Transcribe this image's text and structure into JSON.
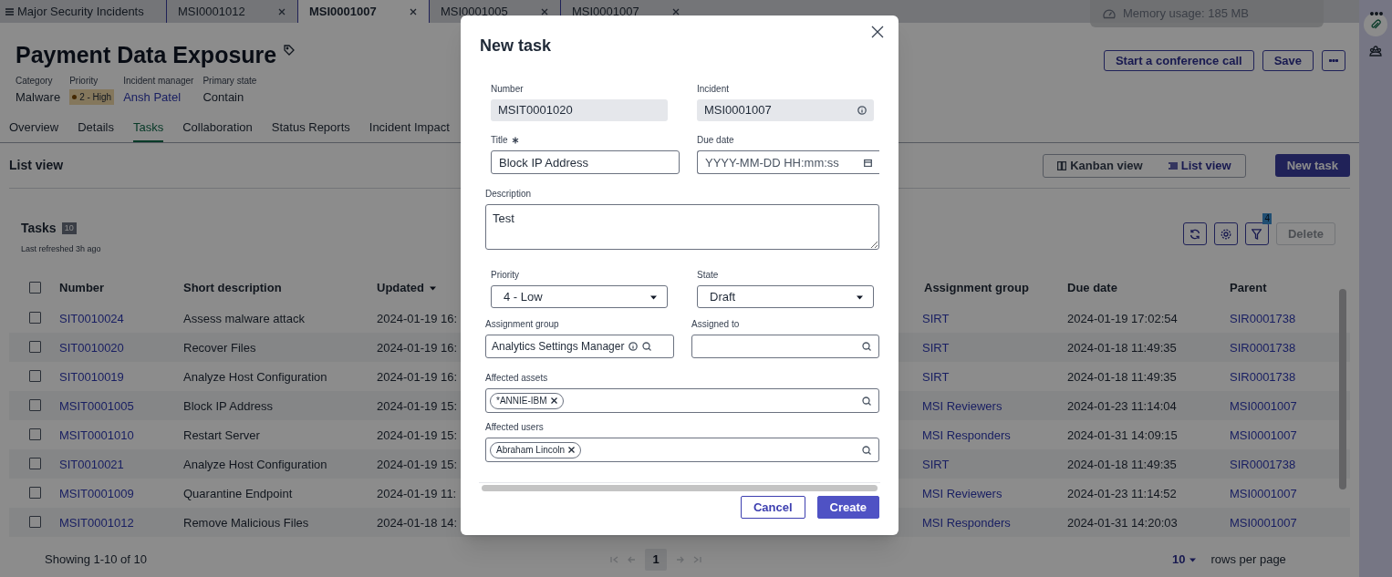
{
  "app_tabs": [
    {
      "label": "Major Security Incidents",
      "kind": "menu",
      "selected": false
    },
    {
      "label": "MSI0001012",
      "kind": "record",
      "selected": false
    },
    {
      "label": "MSI0001007",
      "kind": "record",
      "selected": true
    },
    {
      "label": "MSI0001005",
      "kind": "record",
      "selected": false
    },
    {
      "label": "MSI0001007",
      "kind": "record",
      "selected": false
    }
  ],
  "memory_toast": "Memory usage: 185 MB",
  "record": {
    "title": "Payment Data Exposure",
    "fields": [
      {
        "label": "Category",
        "value": "Malware",
        "kind": "text"
      },
      {
        "label": "Priority",
        "value": "2 - High",
        "kind": "badge"
      },
      {
        "label": "Incident manager",
        "value": "Ansh Patel",
        "kind": "link"
      },
      {
        "label": "Primary state",
        "value": "Contain",
        "kind": "text"
      }
    ],
    "actions": [
      "Start a conference call",
      "Save"
    ]
  },
  "nav_tabs": [
    {
      "label": "Overview",
      "selected": false
    },
    {
      "label": "Details",
      "selected": false
    },
    {
      "label": "Tasks",
      "selected": true
    },
    {
      "label": "Collaboration",
      "selected": false
    },
    {
      "label": "Status Reports",
      "selected": false
    },
    {
      "label": "Incident Impact",
      "selected": false
    }
  ],
  "view_bar": {
    "title": "List view",
    "views": [
      {
        "label": "Kanban view",
        "kind": "kanban",
        "selected": false
      },
      {
        "label": "List view",
        "kind": "list",
        "selected": true
      }
    ],
    "new_button": "New task"
  },
  "tasks": {
    "title": "Tasks",
    "count": "10",
    "refreshed": "Last refreshed 3h ago",
    "filter_count": "4",
    "delete_button": "Delete",
    "select_all_checked": false,
    "columns": [
      "Number",
      "Short description",
      "Updated",
      "Assignment group",
      "Due date",
      "Parent"
    ],
    "rows": [
      {
        "checked": false,
        "cells": [
          "SIT0010024",
          "Assess malware attack",
          "2024-01-19 16:",
          "SIRT",
          "2024-01-19 17:02:54",
          "SIR0001738"
        ]
      },
      {
        "checked": false,
        "cells": [
          "SIT0010020",
          "Recover Files",
          "2024-01-19 16:",
          "SIRT",
          "2024-01-18 11:49:35",
          "SIR0001738"
        ]
      },
      {
        "checked": false,
        "cells": [
          "SIT0010019",
          "Analyze Host Configuration",
          "2024-01-19 16:",
          "SIRT",
          "2024-01-18 11:49:35",
          "SIR0001738"
        ]
      },
      {
        "checked": false,
        "cells": [
          "MSIT0001005",
          "Block IP Address",
          "2024-01-19 15:",
          "MSI Reviewers",
          "2024-01-23 11:14:04",
          "MSI0001007"
        ]
      },
      {
        "checked": false,
        "cells": [
          "MSIT0001010",
          "Restart Server",
          "2024-01-19 15:",
          "MSI Responders",
          "2024-01-31 14:09:15",
          "MSI0001007"
        ]
      },
      {
        "checked": false,
        "cells": [
          "SIT0010021",
          "Analyze Host Configuration",
          "2024-01-19 15:",
          "SIRT",
          "2024-01-18 11:49:35",
          "SIR0001738"
        ]
      },
      {
        "checked": false,
        "cells": [
          "MSIT0001009",
          "Quarantine Endpoint",
          "2024-01-19 11:",
          "MSI Reviewers",
          "2024-01-23 11:14:52",
          "MSI0001007"
        ]
      },
      {
        "checked": false,
        "cells": [
          "MSIT0001012",
          "Remove Malicious Files",
          "2024-01-18 14:",
          "MSI Responders",
          "2024-01-31 14:20:03",
          "MSI0001007"
        ]
      }
    ],
    "showing": "Showing 1-10 of 10",
    "page": "1",
    "rows_per_page": "10",
    "rows_per_page_label": "rows per page"
  },
  "modal": {
    "title": "New task",
    "number": {
      "label": "Number",
      "value": "MSIT0001020"
    },
    "incident": {
      "label": "Incident",
      "value": "MSI0001007"
    },
    "title_field": {
      "label": "Title",
      "required": true,
      "value": "Block IP Address"
    },
    "due_date": {
      "label": "Due date",
      "placeholder": "YYYY-MM-DD HH:mm:ss"
    },
    "description": {
      "label": "Description",
      "value": "Test"
    },
    "priority": {
      "label": "Priority",
      "value": "4 - Low"
    },
    "state": {
      "label": "State",
      "value": "Draft"
    },
    "assignment_group": {
      "label": "Assignment group",
      "value": "Analytics Settings Manager"
    },
    "assigned_to": {
      "label": "Assigned to"
    },
    "affected_assets": {
      "label": "Affected assets",
      "chips": [
        "*ANNIE-IBM"
      ]
    },
    "affected_users": {
      "label": "Affected users",
      "chips": [
        "Abraham Lincoln"
      ]
    },
    "buttons": [
      {
        "label": "Cancel",
        "kind": "secondary"
      },
      {
        "label": "Create",
        "kind": "primary"
      }
    ]
  }
}
